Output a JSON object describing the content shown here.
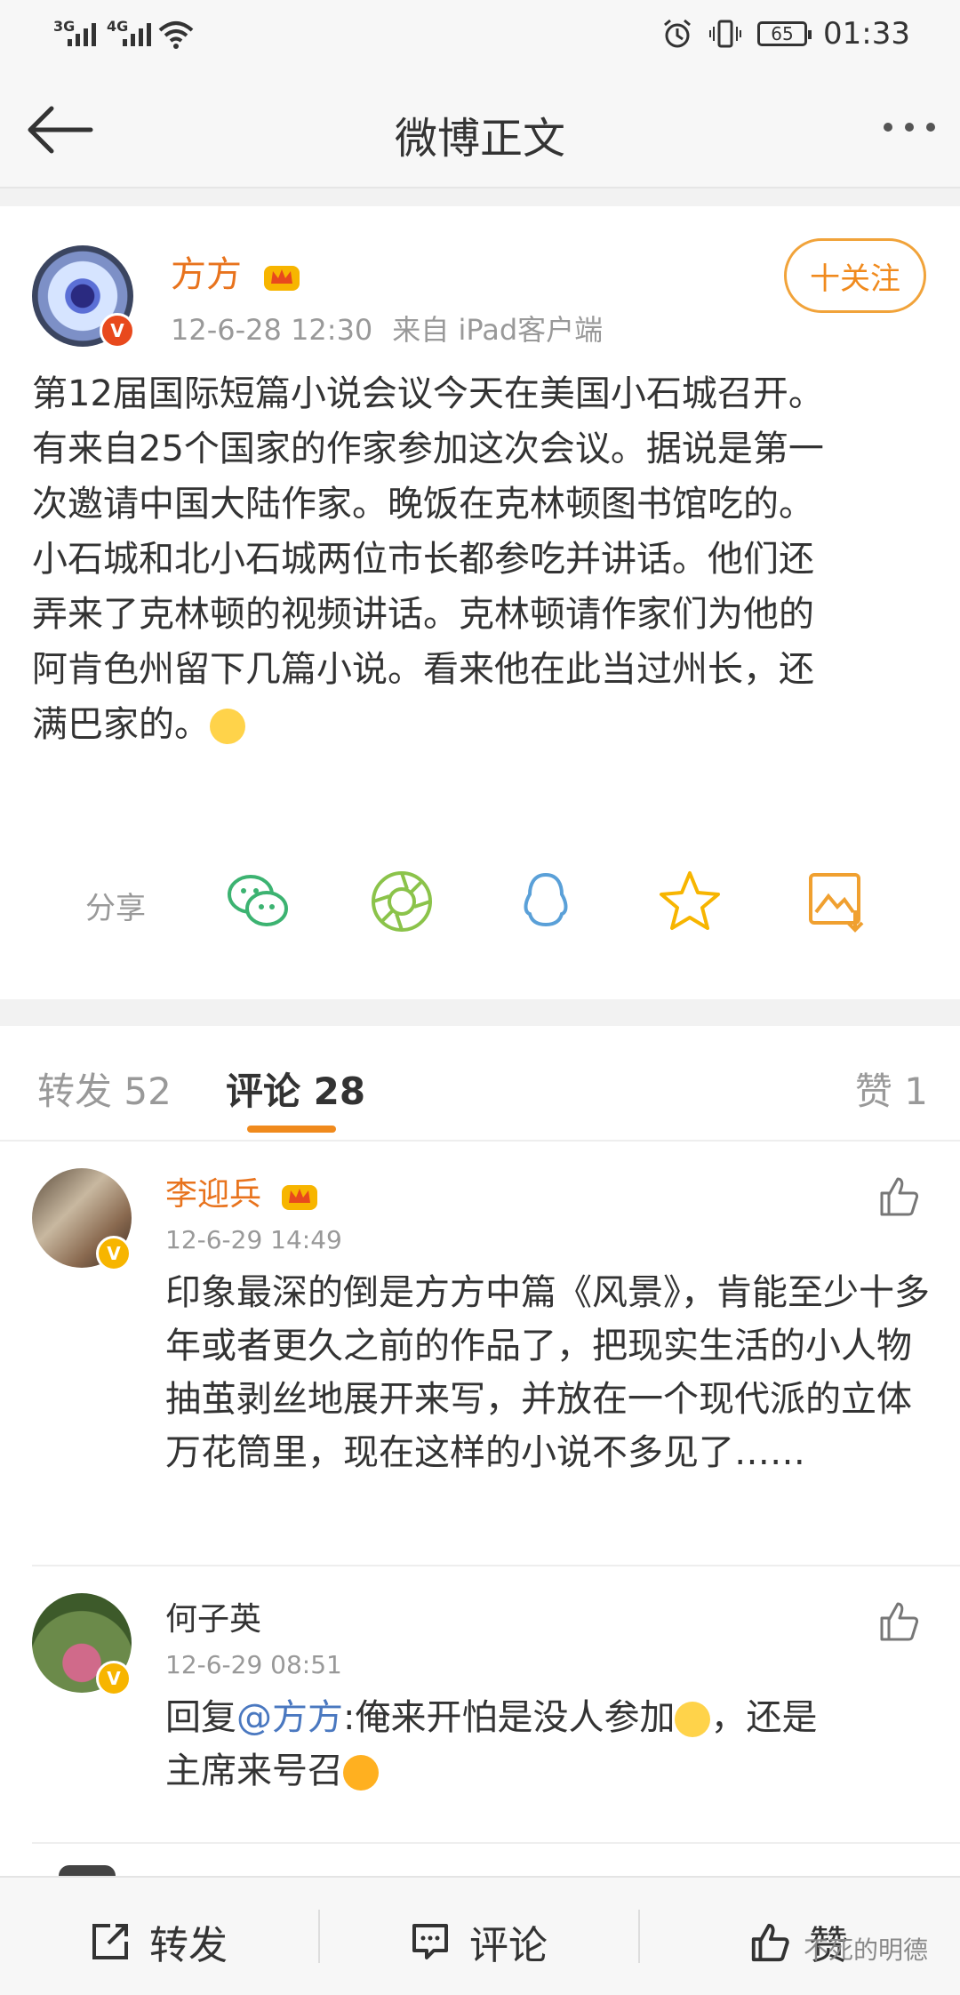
{
  "status_bar": {
    "signal1": "3G",
    "signal2": "4G",
    "battery": "65",
    "time": "01:33"
  },
  "nav": {
    "title": "微博正文"
  },
  "post": {
    "author": "方方",
    "time": "12-6-28 12:30",
    "source": "来自 iPad客户端",
    "follow_label": "十关注",
    "text_lines": [
      "第12届国际短篇小说会议今天在美国小石城召开。",
      "有来自25个国家的作家参加这次会议。据说是第一",
      "次邀请中国大陆作家。晚饭在克林顿图书馆吃的。",
      "小石城和北小石城两位市长都参吃并讲话。他们还",
      "弄来了克林顿的视频讲话。克林顿请作家们为他的",
      "阿肯色州留下几篇小说。看来他在此当过州长，还",
      "满巴家的。"
    ],
    "share_label": "分享",
    "share_icons": [
      "wechat-icon",
      "moments-icon",
      "qq-icon",
      "qzone-star-icon",
      "save-image-icon"
    ]
  },
  "tabs": {
    "repost": "转发 52",
    "comments": "评论 28",
    "likes": "赞 1"
  },
  "comments": [
    {
      "name": "李迎兵",
      "time": "12-6-29 14:49",
      "text": "印象最深的倒是方方中篇《风景》，肯能至少十多年或者更久之前的作品了，把现实生活的小人物抽茧剥丝地展开来写，并放在一个现代派的立体万花筒里，现在这样的小说不多见了……"
    },
    {
      "name": "何子英",
      "time": "12-6-29 08:51",
      "text_prefix": "回复",
      "mention": "@方方",
      "text_mid": ":俺来开怕是没人参加",
      "text_mid2": "，还是",
      "text_line2": "主席来号召"
    }
  ],
  "bottom_bar": {
    "repost": "转发",
    "comment": "评论",
    "like": "赞",
    "watermark": "不死的明德"
  },
  "colors": {
    "accent": "#f08a1d",
    "author": "#e8731d",
    "link": "#4a78c0"
  }
}
